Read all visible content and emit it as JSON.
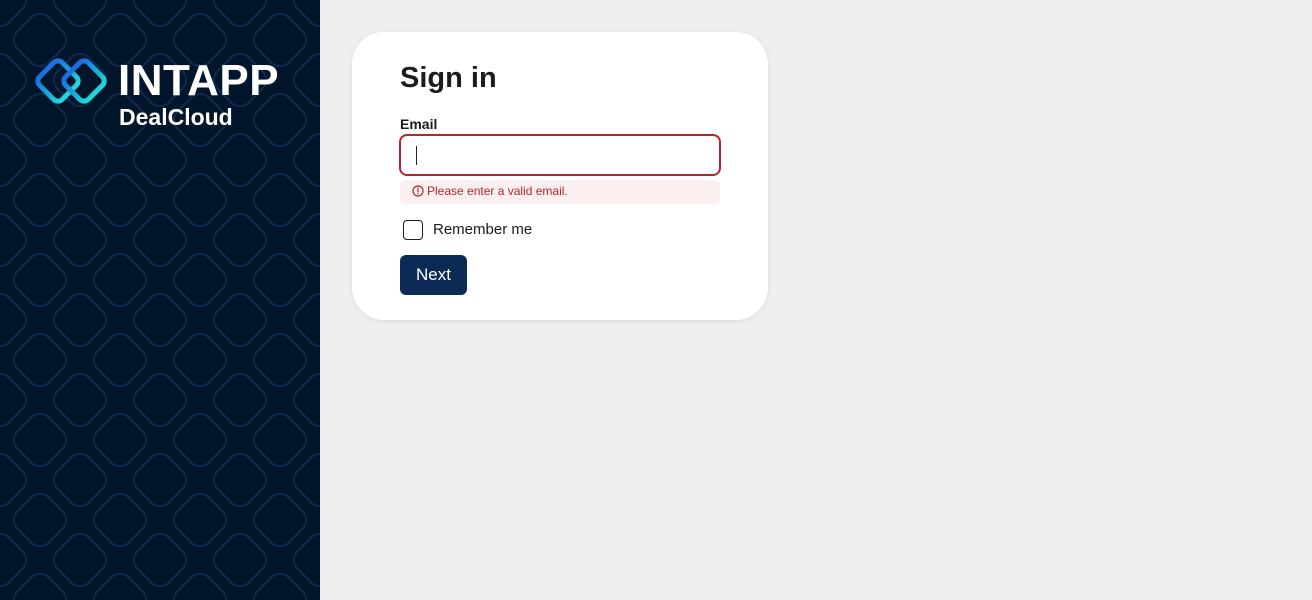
{
  "colors": {
    "sidebar_bg": "#03152b",
    "page_bg": "#f0efee",
    "error": "#b3262f",
    "error_bg": "#fbeff0",
    "primary_button": "#0b2a55",
    "logo_gradient_start": "#1a6fe0",
    "logo_gradient_end": "#20d6d6"
  },
  "brand": {
    "name": "INTAPP",
    "product": "DealCloud",
    "logo_icon": "intapp-logo-icon"
  },
  "signin": {
    "title": "Sign in",
    "email_label": "Email",
    "email_value": "",
    "email_placeholder": "",
    "error_icon": "alert-circle-icon",
    "error_message": "Please enter a valid email.",
    "remember_label": "Remember me",
    "remember_checked": false,
    "next_label": "Next"
  }
}
